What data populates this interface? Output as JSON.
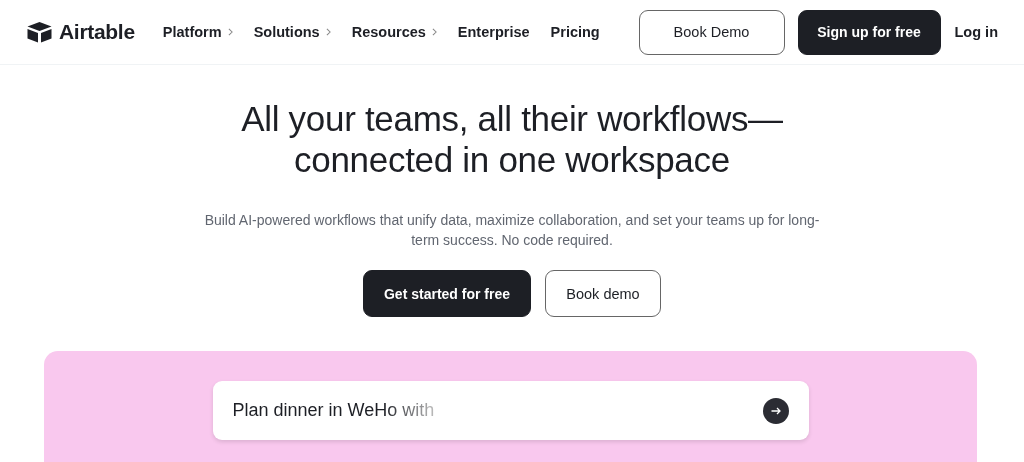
{
  "header": {
    "logo": "Airtable",
    "nav": [
      {
        "label": "Platform",
        "has_submenu": true
      },
      {
        "label": "Solutions",
        "has_submenu": true
      },
      {
        "label": "Resources",
        "has_submenu": true
      },
      {
        "label": "Enterprise",
        "has_submenu": false
      },
      {
        "label": "Pricing",
        "has_submenu": false
      }
    ],
    "book_demo": "Book Demo",
    "sign_up": "Sign up for free",
    "login": "Log in"
  },
  "hero": {
    "title_lines": [
      "All your teams, all their workflows—",
      "connected in one workspace"
    ],
    "subtitle": "Build AI-powered workflows that unify data, maximize collaboration, and set your teams up for long-term success. No code required.",
    "primary_button": "Get started for free",
    "secondary_button": "Book demo"
  },
  "prompt": {
    "value": "Plan dinner in WeHo with"
  }
}
